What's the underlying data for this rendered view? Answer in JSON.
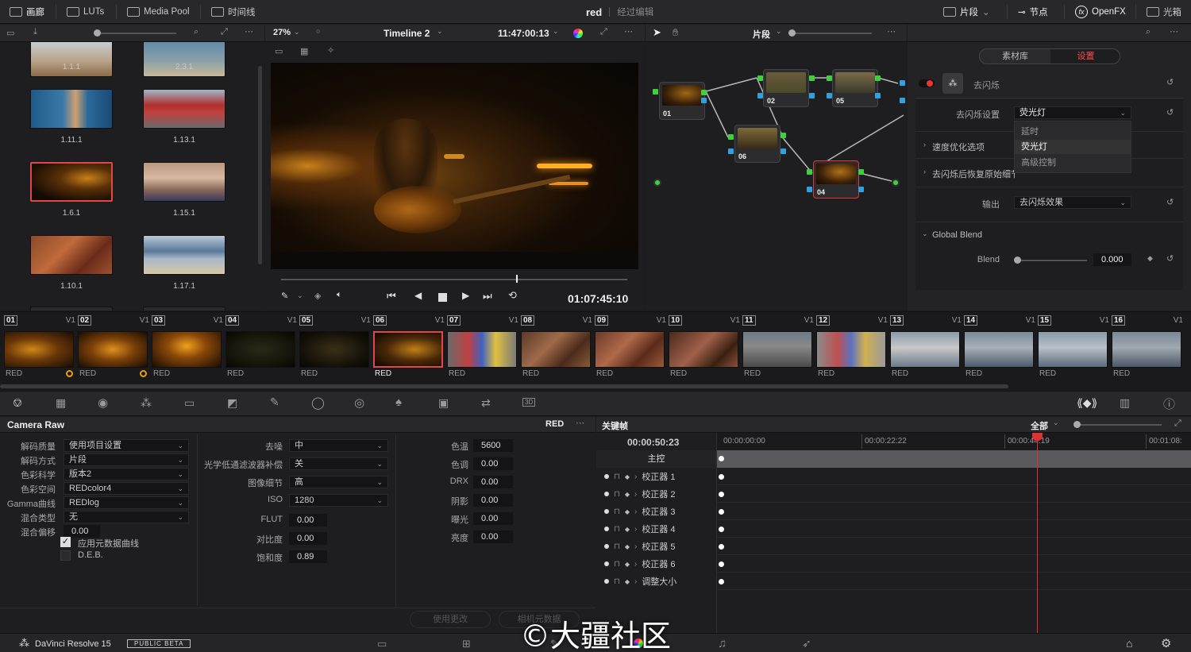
{
  "topbar": {
    "gallery": "画廊",
    "luts": "LUTs",
    "media_pool": "Media Pool",
    "timeline": "时间线",
    "project_name": "red",
    "project_status": "经过编辑",
    "clips": "片段",
    "nodes": "节点",
    "openfx": "OpenFX",
    "lightbox": "光箱"
  },
  "viewer": {
    "zoom": "27%",
    "timeline_name": "Timeline 2",
    "timecode": "11:47:00:13",
    "playhead_tc": "01:07:45:10",
    "mode": "片段"
  },
  "gallery_stills": [
    {
      "label": "1.1.1"
    },
    {
      "label": "2.3.1"
    },
    {
      "label": "1.11.1"
    },
    {
      "label": "1.13.1"
    },
    {
      "label": "1.6.1"
    },
    {
      "label": "1.15.1"
    },
    {
      "label": "1.10.1"
    },
    {
      "label": "1.17.1"
    }
  ],
  "nodes": [
    {
      "label": "01"
    },
    {
      "label": "02"
    },
    {
      "label": "05"
    },
    {
      "label": "06"
    },
    {
      "label": "04"
    }
  ],
  "openfx_panel": {
    "tab_library": "素材库",
    "tab_settings": "设置",
    "effect_name": "去闪烁",
    "deflicker_settings_label": "去闪烁设置",
    "deflicker_settings_value": "荧光灯",
    "dropdown_options": [
      "延时",
      "荧光灯",
      "高级控制"
    ],
    "speed_opt": "速度优化选项",
    "restore_detail": "去闪烁后恢复原始细节",
    "output_label": "输出",
    "output_value": "去闪烁效果",
    "global_blend": "Global Blend",
    "blend_label": "Blend",
    "blend_value": "0.000"
  },
  "clips": [
    {
      "num": "01",
      "track": "V1",
      "codec": "RED"
    },
    {
      "num": "02",
      "track": "V1",
      "codec": "RED"
    },
    {
      "num": "03",
      "track": "V1",
      "codec": "RED"
    },
    {
      "num": "04",
      "track": "V1",
      "codec": "RED"
    },
    {
      "num": "05",
      "track": "V1",
      "codec": "RED"
    },
    {
      "num": "06",
      "track": "V1",
      "codec": "RED"
    },
    {
      "num": "07",
      "track": "V1",
      "codec": "RED"
    },
    {
      "num": "08",
      "track": "V1",
      "codec": "RED"
    },
    {
      "num": "09",
      "track": "V1",
      "codec": "RED"
    },
    {
      "num": "10",
      "track": "V1",
      "codec": "RED"
    },
    {
      "num": "11",
      "track": "V1",
      "codec": "RED"
    },
    {
      "num": "12",
      "track": "V1",
      "codec": "RED"
    },
    {
      "num": "13",
      "track": "V1",
      "codec": "RED"
    },
    {
      "num": "14",
      "track": "V1",
      "codec": "RED"
    },
    {
      "num": "15",
      "track": "V1",
      "codec": "RED"
    },
    {
      "num": "16",
      "track": "V1",
      "codec": "RED"
    }
  ],
  "camera_raw": {
    "title": "Camera Raw",
    "codec": "RED",
    "col1": [
      {
        "label": "解码质量",
        "value": "使用项目设置"
      },
      {
        "label": "解码方式",
        "value": "片段"
      },
      {
        "label": "色彩科学",
        "value": "版本2"
      },
      {
        "label": "色彩空间",
        "value": "REDcolor4"
      },
      {
        "label": "Gamma曲线",
        "value": "REDlog"
      },
      {
        "label": "混合类型",
        "value": "无"
      },
      {
        "label": "混合偏移",
        "value": "0.00"
      }
    ],
    "apply_metadata": "应用元数据曲线",
    "deb": "D.E.B.",
    "col2": [
      {
        "label": "去噪",
        "value": "中"
      },
      {
        "label": "光学低通滤波器补偿",
        "value": "关"
      },
      {
        "label": "图像细节",
        "value": "高"
      },
      {
        "label": "ISO",
        "value": "1280"
      },
      {
        "label": "FLUT",
        "value": "0.00"
      },
      {
        "label": "对比度",
        "value": "0.00"
      },
      {
        "label": "饱和度",
        "value": "0.89"
      }
    ],
    "col3": [
      {
        "label": "色温",
        "value": "5600"
      },
      {
        "label": "色调",
        "value": "0.00"
      },
      {
        "label": "DRX",
        "value": "0.00"
      },
      {
        "label": "阴影",
        "value": "0.00"
      },
      {
        "label": "曝光",
        "value": "0.00"
      },
      {
        "label": "亮度",
        "value": "0.00"
      }
    ],
    "use_changes": "使用更改",
    "camera_meta": "相机元数据"
  },
  "keyframes": {
    "title": "关键帧",
    "filter": "全部",
    "current_tc": "00:00:50:23",
    "ruler": [
      "00:00:00:00",
      "00:00:22:22",
      "00:00:44:19",
      "00:01:08:"
    ],
    "master": "主控",
    "tracks": [
      "校正器 1",
      "校正器 2",
      "校正器 3",
      "校正器 4",
      "校正器 5",
      "校正器 6",
      "调整大小"
    ]
  },
  "footer": {
    "app": "DaVinci Resolve 15",
    "badge": "PUBLIC BETA",
    "watermark": "©大疆社区"
  }
}
